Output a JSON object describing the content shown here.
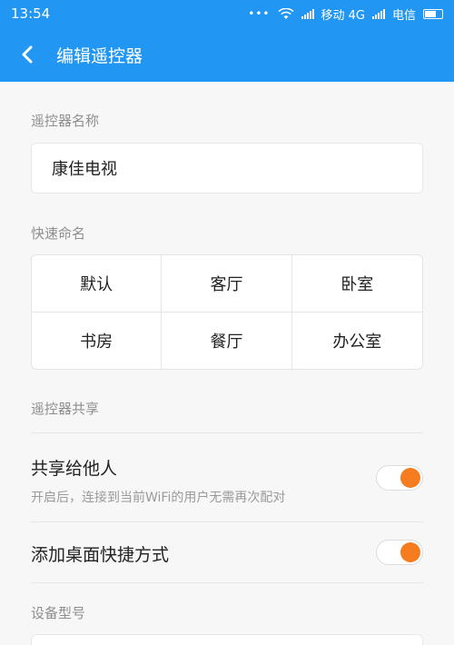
{
  "status": {
    "time": "13:54",
    "dots": "•••",
    "carrier1": "移动 4G",
    "carrier2": "电信"
  },
  "appbar": {
    "title": "编辑遥控器"
  },
  "remote_name": {
    "label": "遥控器名称",
    "value": "康佳电视"
  },
  "quick_name": {
    "label": "快速命名",
    "options": [
      "默认",
      "客厅",
      "卧室",
      "书房",
      "餐厅",
      "办公室"
    ]
  },
  "share": {
    "section_label": "遥控器共享",
    "share_title": "共享给他人",
    "share_desc": "开启后，连接到当前WiFi的用户无需再次配对",
    "share_on": true,
    "shortcut_title": "添加桌面快捷方式",
    "shortcut_on": true
  },
  "device": {
    "label": "设备型号"
  },
  "colors": {
    "primary": "#2196f3",
    "accent": "#f57c1f"
  }
}
